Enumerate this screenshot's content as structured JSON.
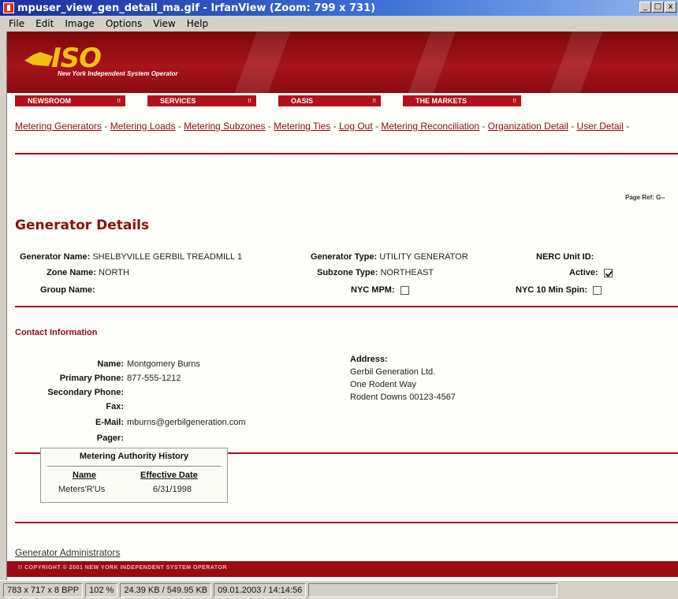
{
  "window": {
    "title": "mpuser_view_gen_detail_ma.gif - IrfanView (Zoom: 799 x 731)",
    "min_glyph": "_",
    "max_glyph": "□",
    "close_glyph": "x"
  },
  "menu": [
    "File",
    "Edit",
    "Image",
    "Options",
    "View",
    "Help"
  ],
  "header": {
    "logo_text": "ISO",
    "logo_subtitle": "New York Independent System Operator",
    "tabs": [
      "NEWSROOM",
      "SERVICES",
      "OASIS",
      "THE MARKETS"
    ],
    "tab_arrow": "!!"
  },
  "links": [
    "Metering Generators",
    "Metering Loads",
    "Metering Subzones",
    "Metering Ties",
    "Log Out",
    "Metering Reconciliation",
    "Organization Detail",
    "User Detail"
  ],
  "link_separator": "-",
  "page_ref": "Page Ref: G--",
  "page_title": "Generator Details",
  "generator": {
    "name_label": "Generator Name:",
    "name_value": "SHELBYVILLE GERBIL TREADMILL 1",
    "type_label": "Generator Type:",
    "type_value": "UTILITY GENERATOR",
    "nerc_label": "NERC Unit ID:",
    "zone_label": "Zone Name:",
    "zone_value": "NORTH",
    "subzone_label": "Subzone Type:",
    "subzone_value": "NORTHEAST",
    "active_label": "Active:",
    "group_label": "Group Name:",
    "nyc_mpm_label": "NYC MPM:",
    "nyc_spin_label": "NYC 10 Min Spin:"
  },
  "contact": {
    "section_title": "Contact Information",
    "name_label": "Name:",
    "name_value": "Montgomery Burns",
    "primary_label": "Primary Phone:",
    "primary_value": "877-555-1212",
    "secondary_label": "Secondary Phone:",
    "fax_label": "Fax:",
    "email_label": "E-Mail:",
    "email_value": "mburns@gerbilgeneration.com",
    "pager_label": "Pager:",
    "address_label": "Address:",
    "address_lines": [
      "Gerbil Generation Ltd.",
      "One Rodent Way",
      "Rodent Downs 00123-4567"
    ]
  },
  "history": {
    "title": "Metering Authority History",
    "col_name": "Name",
    "col_date": "Effective Date",
    "rows": [
      {
        "name": "Meters'R'Us",
        "date": "6/31/1998"
      }
    ]
  },
  "admins_link": "Generator Administrators",
  "footer_copyright": "!! COPYRIGHT © 2001 NEW YORK INDEPENDENT SYSTEM OPERATOR",
  "statusbar": [
    "783 x 717 x 8 BPP",
    "102 %",
    "24.39 KB / 549.95 KB",
    "09.01.2003 / 14:14:56"
  ]
}
